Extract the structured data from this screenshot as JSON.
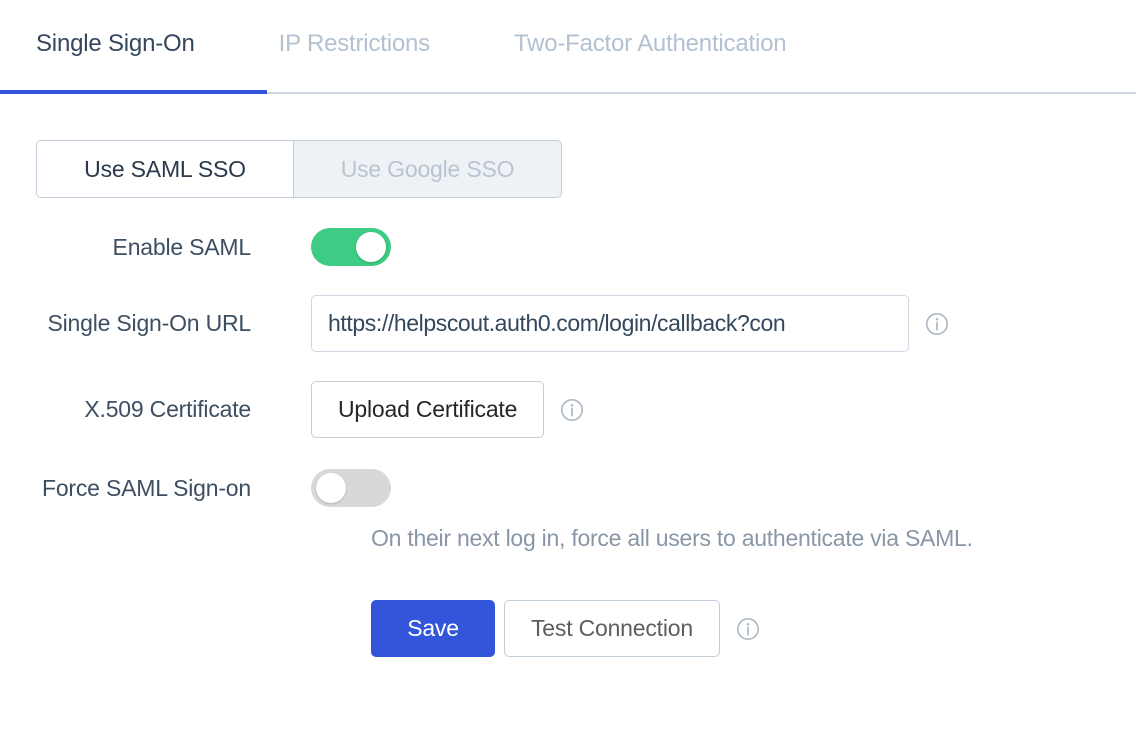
{
  "tabs": [
    {
      "label": "Single Sign-On",
      "active": true
    },
    {
      "label": "IP Restrictions",
      "active": false
    },
    {
      "label": "Two-Factor Authentication",
      "active": false
    }
  ],
  "segmented": {
    "saml_label": "Use SAML SSO",
    "google_label": "Use Google SSO",
    "selected": "Use SAML SSO"
  },
  "form": {
    "enable_saml": {
      "label": "Enable SAML",
      "state": "on"
    },
    "sso_url": {
      "label": "Single Sign-On URL",
      "value": "https://helpscout.auth0.com/login/callback?con",
      "placeholder": "https://"
    },
    "certificate": {
      "label": "X.509 Certificate",
      "button_label": "Upload Certificate"
    },
    "force_saml": {
      "label": "Force SAML Sign-on",
      "state": "off",
      "help": "On their next log in, force all users to authenticate via SAML."
    }
  },
  "actions": {
    "save_label": "Save",
    "test_label": "Test Connection"
  },
  "icons": {
    "info": "info-icon"
  },
  "colors": {
    "accent_blue": "#3355da",
    "toggle_on_green": "#3ecb83",
    "toggle_off_gray": "#d8d8d8",
    "label_text": "#3d4f61",
    "muted_text": "#8896a6",
    "inactive_tab": "#b3c1d1"
  }
}
